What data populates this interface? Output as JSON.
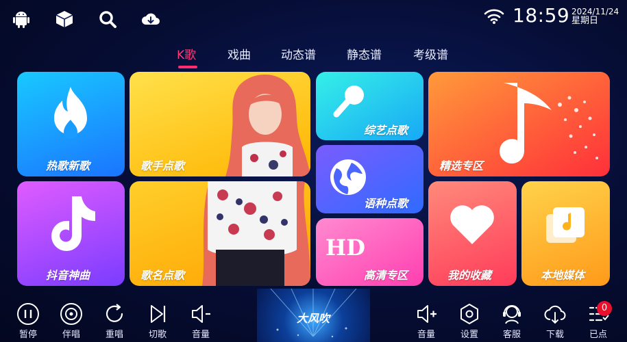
{
  "status": {
    "time": "18:59",
    "date": "2024/11/24",
    "weekday": "星期日"
  },
  "top_icons": [
    "android-icon",
    "box-icon",
    "search-icon",
    "cloud-download-icon"
  ],
  "tabs": [
    {
      "label": "K歌",
      "active": true
    },
    {
      "label": "戏曲",
      "active": false
    },
    {
      "label": "动态谱",
      "active": false
    },
    {
      "label": "静态谱",
      "active": false
    },
    {
      "label": "考级谱",
      "active": false
    }
  ],
  "tiles": {
    "hot_songs": {
      "label": "热歌新歌",
      "icon": "flame-icon",
      "color": "#1aa0ff"
    },
    "singer": {
      "label": "歌手点歌",
      "color": "#ffc21a"
    },
    "variety": {
      "label": "综艺点歌",
      "icon": "microphone-icon",
      "color": "#22d3f0"
    },
    "featured": {
      "label": "精选专区",
      "icon": "music-note-icon",
      "color": "#ff5a3c"
    },
    "douyin": {
      "label": "抖音神曲",
      "icon": "tiktok-icon",
      "color": "#b04cff"
    },
    "song_name": {
      "label": "歌名点歌",
      "color": "#ffb31a"
    },
    "language": {
      "label": "语种点歌",
      "icon": "globe-icon",
      "color": "#5a6bff"
    },
    "hd": {
      "label": "高清专区",
      "icon_text": "HD",
      "color": "#ff5fc2"
    },
    "favorites": {
      "label": "我的收藏",
      "icon": "heart-icon",
      "color": "#ff5a6e"
    },
    "local_media": {
      "label": "本地媒体",
      "icon": "media-library-icon",
      "color": "#ffb21a"
    }
  },
  "bottom_left": [
    {
      "label": "暂停",
      "icon": "pause-icon"
    },
    {
      "label": "伴唱",
      "icon": "disc-icon"
    },
    {
      "label": "重唱",
      "icon": "replay-icon"
    },
    {
      "label": "切歌",
      "icon": "skip-next-icon"
    },
    {
      "label": "音量",
      "icon": "volume-down-icon"
    }
  ],
  "bottom_right": [
    {
      "label": "音量",
      "icon": "volume-up-icon"
    },
    {
      "label": "设置",
      "icon": "settings-icon"
    },
    {
      "label": "客服",
      "icon": "support-icon"
    },
    {
      "label": "下载",
      "icon": "download-icon"
    },
    {
      "label": "已点",
      "icon": "playlist-icon"
    }
  ],
  "queue_count": "0",
  "video": {
    "title": "大风吹"
  }
}
